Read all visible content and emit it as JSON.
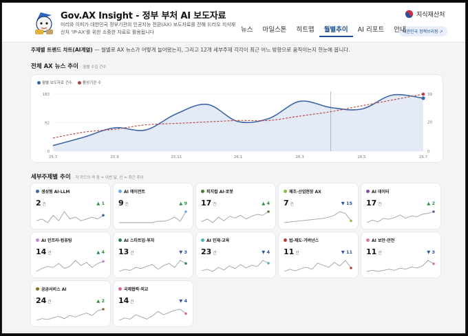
{
  "header": {
    "title": "Gov.AX Insight - 정부 부처 AI 보도자료",
    "subtitle": "미리와 이피가 대한민국 정부기관의 인공지능 전환(AX) 보도자료를 전해 드리오 지식재산처 'IP-AX'를 위한 소중한 자료로 활용됩니다",
    "agency": "지식재산처",
    "agency_button": "대한민국 정책브리핑 ↗"
  },
  "nav": {
    "items": [
      "뉴스",
      "마일스톤",
      "히트맵",
      "월별추이",
      "AI 리포트",
      "안내"
    ],
    "active_index": 3
  },
  "intro": {
    "bold": "주제별 트렌드 차트(AI계열)",
    "text": " — 월별로 AX 뉴스가 어떻게 늘어왔는지, 그리고 12개 세부주제 각각이 최근 어느 방향으로 움직이는지 한눈에 봅니다."
  },
  "main_chart": {
    "title": "전체 AX 뉴스 추이",
    "note": "· 월별 수집 건수",
    "legend": [
      "월별 보도자료 건수",
      "활성기관 수"
    ]
  },
  "subtopics": {
    "title": "세부주제별 추이",
    "note": "· 각 카드의 색 점 = 이번 달, 선 = 최근 추이",
    "unit": "건"
  },
  "colors": {
    "series1": "#3a63a8",
    "series2": "#b0413e",
    "fill": "#dfe6f3",
    "up": "#2e8b3e",
    "down": "#2b4f9c"
  },
  "chart_data": [
    {
      "type": "line",
      "title": "전체 AX 뉴스 추이",
      "x": [
        "25.7",
        "25.8",
        "25.9",
        "25.10",
        "25.11",
        "25.12",
        "26.1",
        "26.2",
        "26.3",
        "26.4",
        "26.5",
        "26.6",
        "26.7"
      ],
      "x_tick_labels": [
        "25.7",
        "25.9",
        "25.11",
        "26.1",
        "26.3",
        "26.5",
        "26.7"
      ],
      "y_left_ticks": [
        "0",
        "92",
        "183"
      ],
      "y_right_ticks": [
        "0",
        "20",
        "39"
      ],
      "ylim_left": [
        0,
        183
      ],
      "ylim_right": [
        0,
        39
      ],
      "highlight_x": "26.4",
      "series": [
        {
          "name": "월별 보도자료 건수",
          "axis": "left",
          "area": true,
          "values": [
            18,
            45,
            75,
            68,
            120,
            150,
            95,
            105,
            160,
            140,
            135,
            180,
            170
          ]
        },
        {
          "name": "활성기관 수",
          "axis": "right",
          "values": [
            9,
            13,
            15,
            18,
            19,
            20,
            21,
            21,
            24,
            27,
            31,
            35,
            39
          ]
        }
      ]
    }
  ],
  "cards": [
    {
      "name": "생성형 AI·LLM",
      "color": "#3a63a8",
      "count": 2,
      "delta": 1,
      "dir": "up",
      "spark": [
        4,
        5,
        3,
        7,
        4,
        9,
        5,
        6,
        4,
        5,
        6,
        5,
        7
      ]
    },
    {
      "name": "AI 에이전트",
      "color": "#6fa8dc",
      "count": 9,
      "delta": 9,
      "dir": "up",
      "spark": [
        1,
        1,
        1,
        1,
        1,
        1,
        1,
        2,
        2,
        3,
        5,
        2,
        9
      ]
    },
    {
      "name": "피지컬 AI·로봇",
      "color": "#4c7a34",
      "count": 17,
      "delta": 4,
      "dir": "up",
      "spark": [
        6,
        9,
        5,
        11,
        7,
        12,
        10,
        13,
        9,
        12,
        14,
        13,
        17
      ]
    },
    {
      "name": "제조·산업현장 AX",
      "color": "#8fbc4b",
      "count": 7,
      "delta": 15,
      "dir": "down",
      "spark": [
        4,
        5,
        6,
        7,
        8,
        9,
        10,
        11,
        13,
        16,
        22,
        19,
        7
      ]
    },
    {
      "name": "AI 데이터",
      "color": "#7b4fa8",
      "count": 17,
      "delta": 2,
      "dir": "up",
      "spark": [
        4,
        7,
        5,
        9,
        8,
        10,
        13,
        9,
        12,
        11,
        14,
        15,
        17
      ]
    },
    {
      "name": "AI 인프라·컴퓨팅",
      "color": "#c585d6",
      "count": 14,
      "delta": 4,
      "dir": "up",
      "spark": [
        4,
        7,
        9,
        8,
        12,
        7,
        9,
        15,
        10,
        13,
        8,
        12,
        14
      ]
    },
    {
      "name": "AI 스타트업·투자",
      "color": "#2e7d5b",
      "count": 13,
      "delta": 3,
      "dir": "down",
      "spark": [
        5,
        7,
        6,
        9,
        8,
        10,
        12,
        7,
        11,
        13,
        9,
        16,
        13
      ]
    },
    {
      "name": "AI 인재·교육",
      "color": "#4fb3b3",
      "count": 23,
      "delta": 4,
      "dir": "down",
      "spark": [
        12,
        14,
        11,
        17,
        13,
        19,
        15,
        21,
        16,
        20,
        18,
        27,
        23
      ]
    },
    {
      "name": "법·제도·거버넌스",
      "color": "#b0413e",
      "count": 11,
      "delta": 11,
      "dir": "down",
      "spark": [
        6,
        9,
        7,
        10,
        12,
        9,
        18,
        15,
        12,
        19,
        14,
        22,
        11
      ]
    },
    {
      "name": "AI 보안·안전",
      "color": "#d77a8c",
      "count": 11,
      "delta": 3,
      "dir": "down",
      "spark": [
        4,
        5,
        4,
        5,
        6,
        5,
        7,
        6,
        8,
        7,
        9,
        14,
        11
      ]
    },
    {
      "name": "공공서비스 AI",
      "color": "#8a6d2a",
      "count": 24,
      "delta": 2,
      "dir": "up",
      "spark": [
        10,
        12,
        11,
        13,
        15,
        12,
        16,
        14,
        17,
        19,
        16,
        22,
        24
      ]
    },
    {
      "name": "국제협력·외교",
      "color": "#d0689a",
      "count": 14,
      "delta": 4,
      "dir": "down",
      "spark": [
        8,
        10,
        9,
        13,
        11,
        9,
        12,
        16,
        13,
        15,
        17,
        18,
        14
      ]
    }
  ]
}
